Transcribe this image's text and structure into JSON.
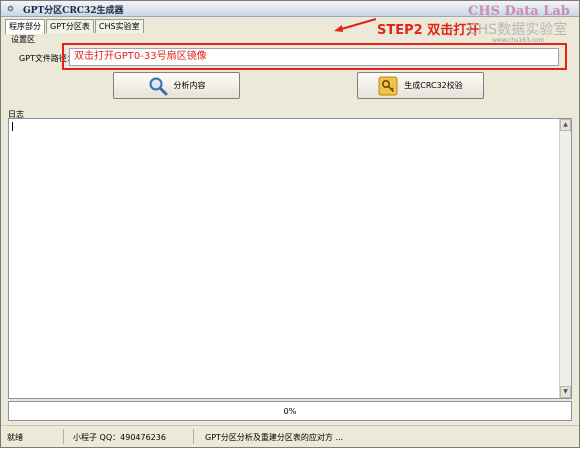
{
  "window": {
    "title": "GPT分区CRC32生成器",
    "tabs": [
      {
        "label": "程序部分",
        "active": true
      },
      {
        "label": "GPT分区表",
        "active": false
      },
      {
        "label": "CHS实验室",
        "active": false
      }
    ]
  },
  "settings": {
    "group_label": "设置区",
    "path_label": "GPT文件路径：",
    "path_value": "双击打开GPT0-33号扇区镜像",
    "analyze_button": "分析内容",
    "crc_button": "生成CRC32校验"
  },
  "log": {
    "label": "日志",
    "content": ""
  },
  "progress": {
    "value": 0,
    "text": "0%"
  },
  "status": {
    "state": "就绪",
    "author": "小程子 QQ：490476236",
    "message": "GPT分区分析及重建分区表的应对方 ..."
  },
  "annotation": {
    "step_text": "STEP2 双击打开",
    "color": "#e2231a"
  },
  "watermark": {
    "title": "CHS Data Lab",
    "subtitle": "CHS数据实验室",
    "url": "www.chs163.com"
  },
  "icons": {
    "app": "gear-icon",
    "analyze": "magnifier-icon",
    "crc": "key-icon"
  }
}
